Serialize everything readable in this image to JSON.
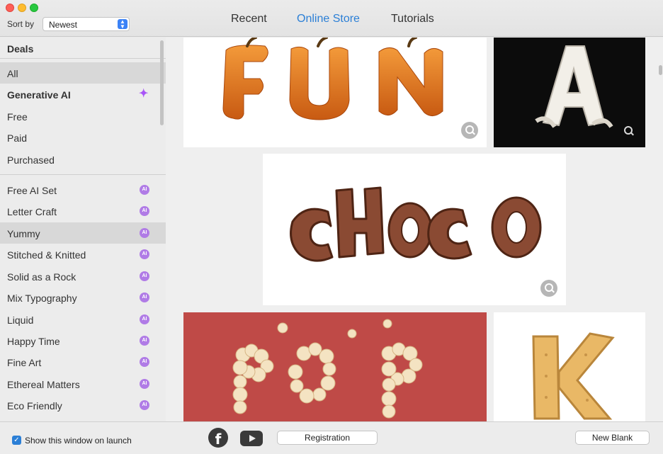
{
  "titlebar": {
    "sort_label": "Sort by",
    "sort_value": "Newest",
    "tabs": [
      "Recent",
      "Online Store",
      "Tutorials"
    ]
  },
  "sidebar": {
    "deals": "Deals",
    "items": [
      "All",
      "Generative AI",
      "Free",
      "Paid",
      "Purchased"
    ],
    "sets": [
      "Free AI Set",
      "Letter Craft",
      "Yummy",
      "Stitched & Knitted",
      "Solid as a Rock",
      "Mix Typography",
      "Liquid",
      "Happy Time",
      "Fine Art",
      "Ethereal Matters",
      "Eco Friendly"
    ],
    "ai_badge": "AI"
  },
  "content": {
    "cards": [
      "FUN",
      "A",
      "CHOCO",
      "POP",
      "K"
    ]
  },
  "bottombar": {
    "show_on_launch": "Show this window on launch",
    "registration": "Registration",
    "new_blank": "New Blank"
  },
  "colors": {
    "accent": "#2b7fd6",
    "ai_badge": "#b07be6",
    "sparkle": "#a855f7"
  }
}
